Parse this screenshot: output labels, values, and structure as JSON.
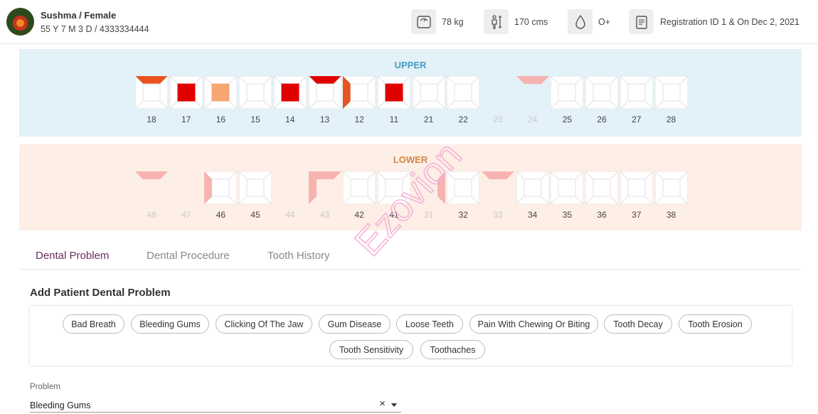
{
  "patient": {
    "name_gender": "Sushma / Female",
    "age_phone": "55 Y 7 M 3 D / 4333334444"
  },
  "stats": {
    "weight": "78 kg",
    "height": "170 cms",
    "blood_group": "O+",
    "registration": "Registration ID 1 & On Dec 2, 2021"
  },
  "chart": {
    "upper_title": "UPPER",
    "lower_title": "LOWER",
    "colors": {
      "red": "#e00000",
      "orange_red": "#e8521c",
      "light_orange": "#f5a673",
      "pink": "#f6b3b0",
      "missing_fill": "#ececec"
    },
    "upper": [
      {
        "num": "18",
        "mark": "top-orange-red"
      },
      {
        "num": "17",
        "mark": "center-red"
      },
      {
        "num": "16",
        "mark": "center-light-orange"
      },
      {
        "num": "15",
        "mark": "none"
      },
      {
        "num": "14",
        "mark": "center-red"
      },
      {
        "num": "13",
        "mark": "top-red"
      },
      {
        "num": "12",
        "mark": "left-orange"
      },
      {
        "num": "11",
        "mark": "center-red"
      },
      {
        "num": "21",
        "mark": "none"
      },
      {
        "num": "22",
        "mark": "none"
      },
      {
        "num": "23",
        "mark": "missing"
      },
      {
        "num": "24",
        "mark": "missing-top-pink"
      },
      {
        "num": "25",
        "mark": "none"
      },
      {
        "num": "26",
        "mark": "none"
      },
      {
        "num": "27",
        "mark": "none"
      },
      {
        "num": "28",
        "mark": "none"
      }
    ],
    "lower": [
      {
        "num": "48",
        "mark": "missing-top-pink"
      },
      {
        "num": "47",
        "mark": "missing"
      },
      {
        "num": "46",
        "mark": "left-pink"
      },
      {
        "num": "45",
        "mark": "none"
      },
      {
        "num": "44",
        "mark": "missing"
      },
      {
        "num": "43",
        "mark": "missing-left-top-pink"
      },
      {
        "num": "42",
        "mark": "none"
      },
      {
        "num": "41",
        "mark": "none"
      },
      {
        "num": "31",
        "mark": "missing-right-pink"
      },
      {
        "num": "32",
        "mark": "none"
      },
      {
        "num": "33",
        "mark": "missing-top-pink"
      },
      {
        "num": "34",
        "mark": "none"
      },
      {
        "num": "35",
        "mark": "none"
      },
      {
        "num": "36",
        "mark": "none"
      },
      {
        "num": "37",
        "mark": "none"
      },
      {
        "num": "38",
        "mark": "none"
      }
    ]
  },
  "tabs": [
    {
      "label": "Dental Problem",
      "active": true
    },
    {
      "label": "Dental Procedure",
      "active": false
    },
    {
      "label": "Tooth History",
      "active": false
    }
  ],
  "section_title": "Add Patient Dental Problem",
  "problems": [
    "Bad Breath",
    "Bleeding Gums",
    "Clicking Of The Jaw",
    "Gum Disease",
    "Loose Teeth",
    "Pain With Chewing Or Biting",
    "Tooth Decay",
    "Tooth Erosion",
    "Tooth Sensitivity",
    "Toothaches"
  ],
  "problem_field": {
    "label": "Problem",
    "value": "Bleeding Gums",
    "clear_icon": "×"
  },
  "watermark": "Ezovion",
  "icons": {
    "weight": "scale-icon",
    "height": "height-icon",
    "blood": "blood-drop-icon",
    "registration": "clipboard-icon"
  }
}
